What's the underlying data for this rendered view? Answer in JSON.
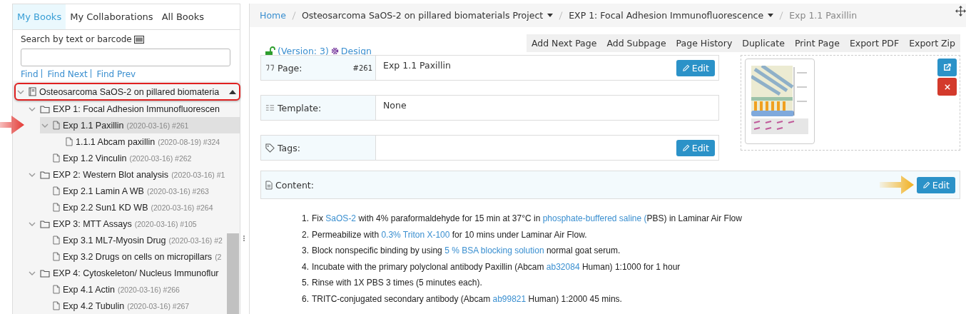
{
  "sidebar": {
    "tabs": [
      {
        "label": "My Books",
        "selected": true
      },
      {
        "label": "My Collaborations",
        "selected": false
      },
      {
        "label": "All Books",
        "selected": false
      }
    ],
    "search": {
      "label": "Search by text or barcode"
    },
    "find_links": [
      "Find",
      "Find Next",
      "Find Prev"
    ],
    "tree": [
      {
        "kind": "book",
        "label": "Osteosarcoma SaOS-2 on pillared biomateria",
        "expanded": true,
        "selected": false,
        "outlined": true,
        "children": [
          {
            "kind": "folder",
            "label": "EXP 1: Focal Adhesion Immunofluorescen",
            "expanded": true,
            "selected": false,
            "children": [
              {
                "kind": "page",
                "label": "Exp 1.1 Paxillin",
                "meta": "(2020-03-16) #261",
                "expanded": true,
                "selected": true,
                "pointed": true,
                "children": [
                  {
                    "kind": "page",
                    "label": "1.1.1 Abcam paxillin",
                    "meta": "(2020-08-19) #324",
                    "selected": false
                  }
                ]
              },
              {
                "kind": "page",
                "label": "Exp 1.2 Vinculin",
                "meta": "(2020-03-16) #262",
                "selected": false
              }
            ]
          },
          {
            "kind": "folder",
            "label": "EXP 2: Western Blot analysis",
            "meta": "(2020-03-16) #1",
            "expanded": true,
            "selected": false,
            "children": [
              {
                "kind": "page",
                "label": "Exp 2.1 Lamin A WB",
                "meta": "(2020-03-16) #263",
                "selected": false
              },
              {
                "kind": "page",
                "label": "Exp 2.2 Sun1 KD WB",
                "meta": "(2020-03-16) #264",
                "selected": false
              }
            ]
          },
          {
            "kind": "folder",
            "label": "EXP 3: MTT Assays",
            "meta": "(2020-03-16) #105",
            "expanded": true,
            "selected": false,
            "children": [
              {
                "kind": "page",
                "label": "Exp 3.1 ML7-Myosin Drug",
                "meta": "(2020-03-16) #2",
                "selected": false
              },
              {
                "kind": "page",
                "label": "Exp 3.2 Drugs on cells on micropillars",
                "meta": "(2",
                "selected": false
              }
            ]
          },
          {
            "kind": "folder",
            "label": "EXP 4: Cytoskeleton/ Nucleus Immunoflur",
            "expanded": true,
            "selected": false,
            "children": [
              {
                "kind": "page",
                "label": "Exp 4.1 Actin",
                "meta": "(2020-03-16) #266",
                "selected": false
              },
              {
                "kind": "page",
                "label": "Exp 4.2 Tubulin",
                "meta": "(2020-03-16) #267",
                "selected": false
              }
            ]
          }
        ]
      }
    ]
  },
  "breadcrumb": [
    {
      "kind": "link",
      "label": "Home"
    },
    {
      "kind": "dropdown",
      "label": "Osteosarcoma SaOS-2 on pillared biomaterials Project"
    },
    {
      "kind": "dropdown",
      "label": "EXP 1: Focal Adhesion Immunofluorescence"
    },
    {
      "kind": "current",
      "label": "Exp 1.1 Paxillin"
    }
  ],
  "toolbar": {
    "locked": false,
    "version": "(Version: 3)",
    "design": "Design",
    "actions": [
      "Add Next Page",
      "Add Subpage",
      "Page History",
      "Duplicate",
      "Print Page",
      "Export PDF",
      "Export Zip"
    ]
  },
  "fields": [
    {
      "kind": "page",
      "label": "Page:",
      "number": "#261",
      "value": "Exp 1.1 Paxillin",
      "edit": "Edit"
    },
    {
      "kind": "template",
      "label": "Template:",
      "value": "None"
    },
    {
      "kind": "tags",
      "label": "Tags:",
      "edit": "Edit"
    }
  ],
  "content": {
    "label": "Content:",
    "edit": "Edit",
    "edit_callout": true,
    "steps": [
      {
        "number": "1.",
        "parts": [
          {
            "kind": "text",
            "text": "Fix "
          },
          {
            "kind": "link",
            "text": "SaOS-2"
          },
          {
            "kind": "text",
            "text": " with 4% paraformaldehyde for 15 min at 37°C in "
          },
          {
            "kind": "link",
            "text": "phosphate-buffered saline ("
          },
          {
            "kind": "text",
            "text": "PBS) in Laminar Air Flow"
          }
        ]
      },
      {
        "number": "2.",
        "parts": [
          {
            "kind": "text",
            "text": "Permeabilize with "
          },
          {
            "kind": "link",
            "text": "0.3% Triton X-100"
          },
          {
            "kind": "text",
            "text": " for 10 mins under Laminar Air Flow."
          }
        ]
      },
      {
        "number": "3.",
        "parts": [
          {
            "kind": "text",
            "text": "Block nonspecific binding by using "
          },
          {
            "kind": "link",
            "text": "5 % BSA blocking solution"
          },
          {
            "kind": "text",
            "text": " normal goat serum."
          }
        ]
      },
      {
        "number": "4.",
        "parts": [
          {
            "kind": "text",
            "text": "Incubate with the primary polyclonal antibody Paxillin (Abcam "
          },
          {
            "kind": "link",
            "text": "ab32084"
          },
          {
            "kind": "text",
            "text": " Human) 1:1000 for 1 hour"
          }
        ]
      },
      {
        "number": "5.",
        "parts": [
          {
            "kind": "text",
            "text": "Rinse with 1X PBS 3 times (5 minutes each)."
          }
        ]
      },
      {
        "number": "6.",
        "parts": [
          {
            "kind": "text",
            "text": "TRITC-conjugated secondary antibody (Abcam "
          },
          {
            "kind": "link",
            "text": "ab99821"
          },
          {
            "kind": "text",
            "text": " Human) 1:2000 45 mins."
          }
        ]
      }
    ]
  }
}
